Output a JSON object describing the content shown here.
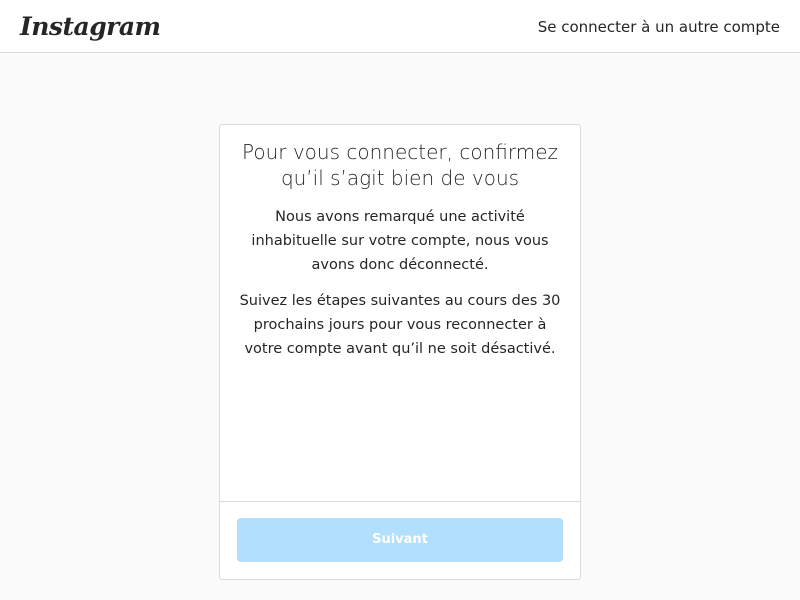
{
  "header": {
    "logo_text": "Instagram",
    "switch_account_label": "Se connecter à un autre compte"
  },
  "card": {
    "title": "Pour vous connecter, confirmez qu’il s’agit bien de vous",
    "paragraph_1": "Nous avons remarqué une activité inhabituelle sur votre compte, nous vous avons donc déconnecté.",
    "paragraph_2": "Suivez les étapes suivantes au cours des 30 prochains jours pour vous reconnecter à votre compte avant qu’il ne soit désactivé.",
    "next_button_label": "Suivant"
  },
  "colors": {
    "page_background": "#fafafa",
    "header_background": "#ffffff",
    "border": "#dbdbdb",
    "button_disabled": "#b2dffc",
    "text": "#262626"
  }
}
